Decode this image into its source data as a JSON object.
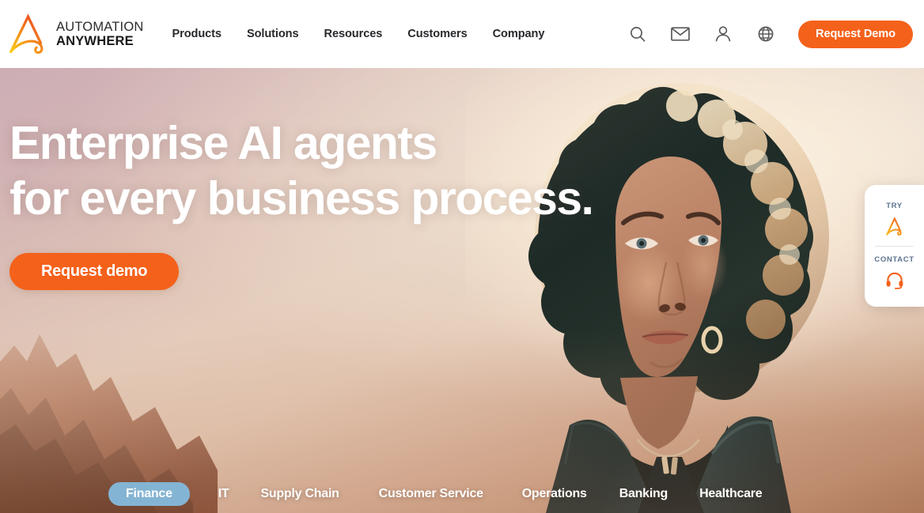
{
  "header": {
    "logo": {
      "icon": "automation-anywhere-a-logo",
      "line1": "AUTOMATION",
      "line2": "ANYWHERE"
    },
    "nav": [
      {
        "label": "Products"
      },
      {
        "label": "Solutions"
      },
      {
        "label": "Resources"
      },
      {
        "label": "Customers"
      },
      {
        "label": "Company"
      }
    ],
    "icons": [
      {
        "name": "search-icon",
        "label": "Search"
      },
      {
        "name": "mail-icon",
        "label": "Contact"
      },
      {
        "name": "user-icon",
        "label": "Account"
      },
      {
        "name": "globe-icon",
        "label": "Language"
      }
    ],
    "cta": {
      "label": "Request Demo"
    }
  },
  "hero": {
    "headline_line1": "Enterprise AI agents",
    "headline_line2": "for every business process.",
    "cta": {
      "label": "Request demo"
    }
  },
  "side_widget": {
    "try": {
      "label": "TRY",
      "icon": "automation-anywhere-a-logo"
    },
    "contact": {
      "label": "CONTACT",
      "icon": "headset-icon"
    }
  },
  "tabs": [
    {
      "label": "Finance",
      "active": true
    },
    {
      "label": "IT",
      "active": false
    },
    {
      "label": "Supply Chain",
      "active": false
    },
    {
      "label": "Customer Service",
      "active": false
    },
    {
      "label": "Operations",
      "active": false
    },
    {
      "label": "Banking",
      "active": false
    },
    {
      "label": "Healthcare",
      "active": false
    }
  ],
  "colors": {
    "brand_orange": "#f4611a",
    "logo_gradient_start": "#f5c518",
    "logo_gradient_end": "#e8402a",
    "active_tab_blue": "#84b4d3",
    "widget_label_blue": "#5e7390",
    "nav_text": "#27292c"
  }
}
